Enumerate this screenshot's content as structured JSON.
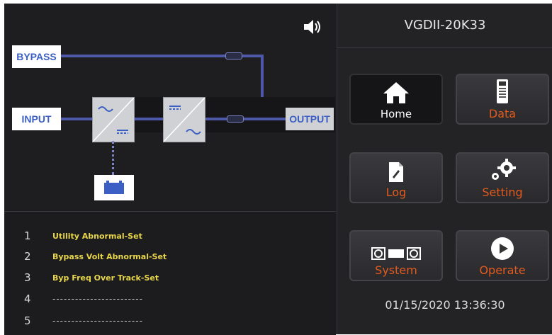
{
  "header": {
    "model": "VGDII-20K33"
  },
  "diagram": {
    "bypass_label": "BYPASS",
    "input_label": "INPUT",
    "output_label": "OUTPUT"
  },
  "menu": [
    {
      "label": "Home",
      "icon": "home-icon"
    },
    {
      "label": "Data",
      "icon": "data-icon"
    },
    {
      "label": "Log",
      "icon": "log-icon"
    },
    {
      "label": "Setting",
      "icon": "gear-icon"
    },
    {
      "label": "System",
      "icon": "system-icon"
    },
    {
      "label": "Operate",
      "icon": "play-icon"
    }
  ],
  "alarms": [
    {
      "num": "1",
      "text": "Utility Abnormal-Set"
    },
    {
      "num": "2",
      "text": "Bypass Volt Abnormal-Set"
    },
    {
      "num": "3",
      "text": "Byp Freq Over Track-Set"
    },
    {
      "num": "4",
      "text": "------------------------"
    },
    {
      "num": "5",
      "text": "------------------------"
    }
  ],
  "status": {
    "datetime": "01/15/2020  13:36:30"
  },
  "colors": {
    "accent": "#e35a1e",
    "alarm_text": "#e7d64a",
    "flow_line": "#4f58a8"
  }
}
